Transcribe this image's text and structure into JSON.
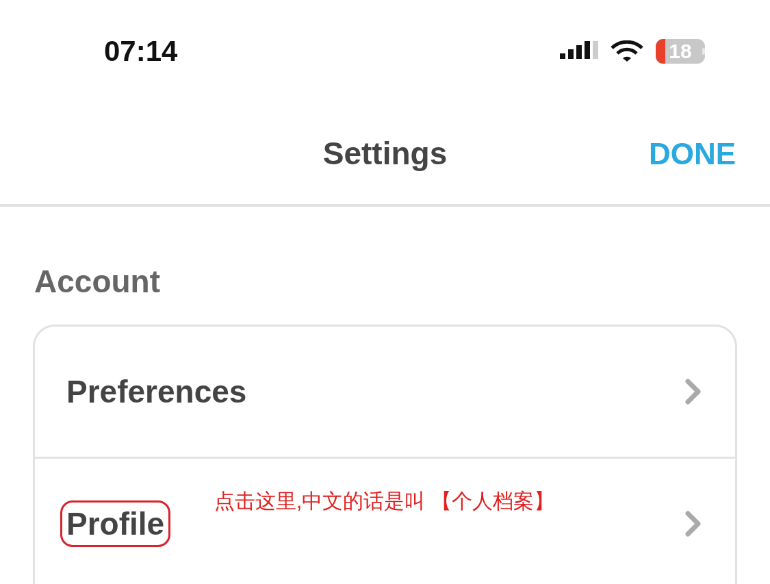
{
  "status_bar": {
    "time": "07:14",
    "battery": "18"
  },
  "header": {
    "title": "Settings",
    "action": "DONE"
  },
  "section": {
    "title": "Account",
    "rows": [
      {
        "label": "Preferences",
        "annotated": false
      },
      {
        "label": "Profile",
        "annotated": true,
        "note": "点击这里,中文的话是叫 【个人档案】"
      }
    ]
  }
}
